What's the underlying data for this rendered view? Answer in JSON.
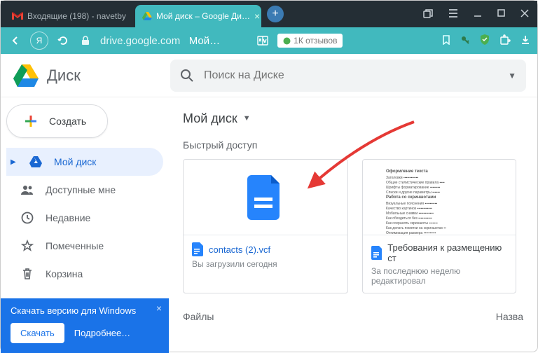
{
  "browser": {
    "tabs": [
      {
        "favicon": "gmail",
        "title": "Входящие (198) - navetby"
      },
      {
        "favicon": "drive",
        "title": "Мой диск – Google Ди…"
      }
    ],
    "url_host": "drive.google.com",
    "url_path": "Мой…",
    "reviews": "1К отзывов"
  },
  "app": {
    "logo_text": "Диск",
    "search_placeholder": "Поиск на Диске",
    "create_label": "Создать"
  },
  "sidebar": {
    "items": [
      {
        "label": "Мой диск"
      },
      {
        "label": "Доступные мне"
      },
      {
        "label": "Недавние"
      },
      {
        "label": "Помеченные"
      },
      {
        "label": "Корзина"
      }
    ]
  },
  "promo": {
    "title": "Скачать версию для Windows",
    "download": "Скачать",
    "more": "Подробнее…"
  },
  "main": {
    "breadcrumb": "Мой диск",
    "quick_access": "Быстрый доступ",
    "cards": [
      {
        "name": "contacts (2).vcf",
        "sub": "Вы загрузили сегодня"
      },
      {
        "name": "Требования к размещению ст",
        "sub": "За последнюю неделю редактировал"
      }
    ],
    "cols": {
      "files": "Файлы",
      "name": "Назва"
    }
  }
}
